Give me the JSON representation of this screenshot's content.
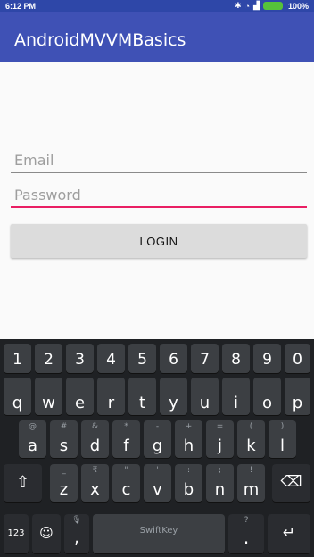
{
  "status_bar": {
    "time": "6:12 PM",
    "battery": "100%"
  },
  "app": {
    "title": "AndroidMVVMBasics"
  },
  "form": {
    "email_placeholder": "Email",
    "password_placeholder": "Password",
    "login_label": "LOGIN"
  },
  "keyboard": {
    "numbers": [
      "1",
      "2",
      "3",
      "4",
      "5",
      "6",
      "7",
      "8",
      "9",
      "0"
    ],
    "row1": [
      "q",
      "w",
      "e",
      "r",
      "t",
      "y",
      "u",
      "i",
      "o",
      "p"
    ],
    "row2": [
      "a",
      "s",
      "d",
      "f",
      "g",
      "h",
      "j",
      "k",
      "l"
    ],
    "row2_hints": [
      "@",
      "#",
      "&",
      "*",
      "-",
      "+",
      "=",
      "(",
      ")"
    ],
    "row3": [
      "z",
      "x",
      "c",
      "v",
      "b",
      "n",
      "m"
    ],
    "row3_hints": [
      "_",
      "₹",
      "\"",
      "'",
      ":",
      ";",
      "!"
    ],
    "symbols_key": "123",
    "space_brand": "SwiftKey",
    "comma": ",",
    "period": "."
  }
}
